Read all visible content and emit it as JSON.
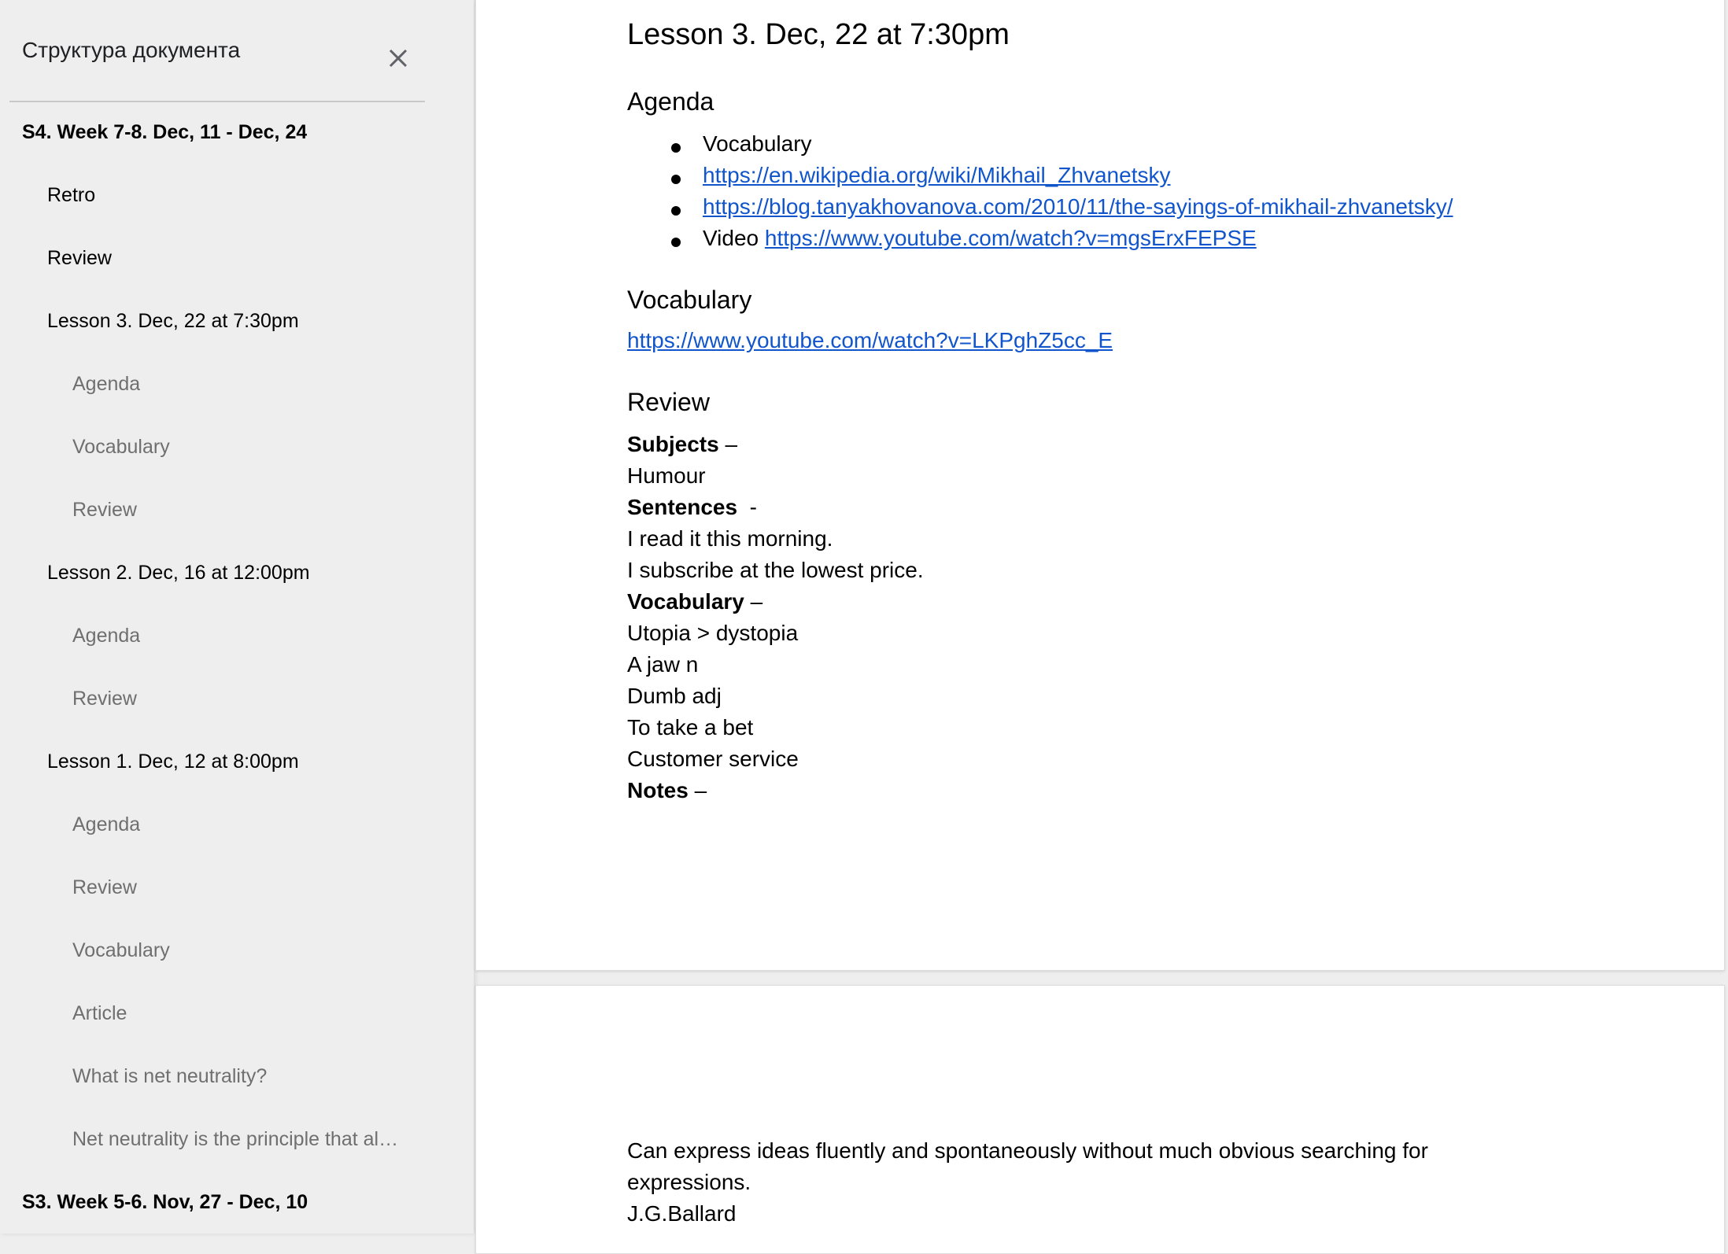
{
  "outline": {
    "title": "Структура документа",
    "items": [
      {
        "text": "S4. Week 7-8. Dec, 11 - Dec, 24",
        "level": 1
      },
      {
        "text": "Retro",
        "level": 2
      },
      {
        "text": "Review",
        "level": 2
      },
      {
        "text": "Lesson 3. Dec, 22 at 7:30pm",
        "level": 2
      },
      {
        "text": "Agenda",
        "level": 3
      },
      {
        "text": "Vocabulary",
        "level": 3
      },
      {
        "text": "Review",
        "level": 3
      },
      {
        "text": "Lesson 2. Dec, 16 at 12:00pm",
        "level": 2
      },
      {
        "text": "Agenda",
        "level": 3
      },
      {
        "text": "Review",
        "level": 3
      },
      {
        "text": "Lesson 1. Dec, 12 at 8:00pm",
        "level": 2
      },
      {
        "text": "Agenda",
        "level": 3
      },
      {
        "text": "Review",
        "level": 3
      },
      {
        "text": "Vocabulary",
        "level": 3
      },
      {
        "text": "Article",
        "level": 3
      },
      {
        "text": "What is net neutrality?",
        "level": 3
      },
      {
        "text": "Net neutrality is the principle that al…",
        "level": 3
      },
      {
        "text": "S3. Week 5-6. Nov, 27 - Dec, 10",
        "level": 1
      }
    ]
  },
  "doc": {
    "lesson_title": "Lesson 3. Dec, 22 at 7:30pm",
    "agenda_heading": "Agenda",
    "agenda_items": [
      {
        "prefix": "Vocabulary",
        "link": ""
      },
      {
        "prefix": "",
        "link": "https://en.wikipedia.org/wiki/Mikhail_Zhvanetsky"
      },
      {
        "prefix": "",
        "link": "https://blog.tanyakhovanova.com/2010/11/the-sayings-of-mikhail-zhvanetsky/"
      },
      {
        "prefix": "Video ",
        "link": "https://www.youtube.com/watch?v=mgsErxFEPSE"
      }
    ],
    "vocabulary_heading": "Vocabulary",
    "vocabulary_link": "https://www.youtube.com/watch?v=LKPghZ5cc_E",
    "review_heading": "Review",
    "review_lines": [
      {
        "bold": "Subjects",
        "text": " –"
      },
      {
        "bold": "",
        "text": "Humour"
      },
      {
        "bold": "Sentences",
        "text": "  -"
      },
      {
        "bold": "",
        "text": "I read it this morning."
      },
      {
        "bold": "",
        "text": "I subscribe at the lowest price."
      },
      {
        "bold": "Vocabulary",
        "text": " –"
      },
      {
        "bold": "",
        "text": "Utopia > dystopia"
      },
      {
        "bold": "",
        "text": "A jaw n"
      },
      {
        "bold": "",
        "text": "Dumb adj"
      },
      {
        "bold": "",
        "text": "To take a bet"
      },
      {
        "bold": "",
        "text": "Customer service"
      },
      {
        "bold": "Notes",
        "text": " –"
      }
    ],
    "page2_lines": [
      "Can express ideas fluently and spontaneously without much obvious searching for",
      "expressions.",
      "J.G.Ballard"
    ]
  },
  "colors": {
    "link": "#1155cc",
    "sidebar_bg": "#eeeeee",
    "muted_text": "#6f6f6f"
  }
}
